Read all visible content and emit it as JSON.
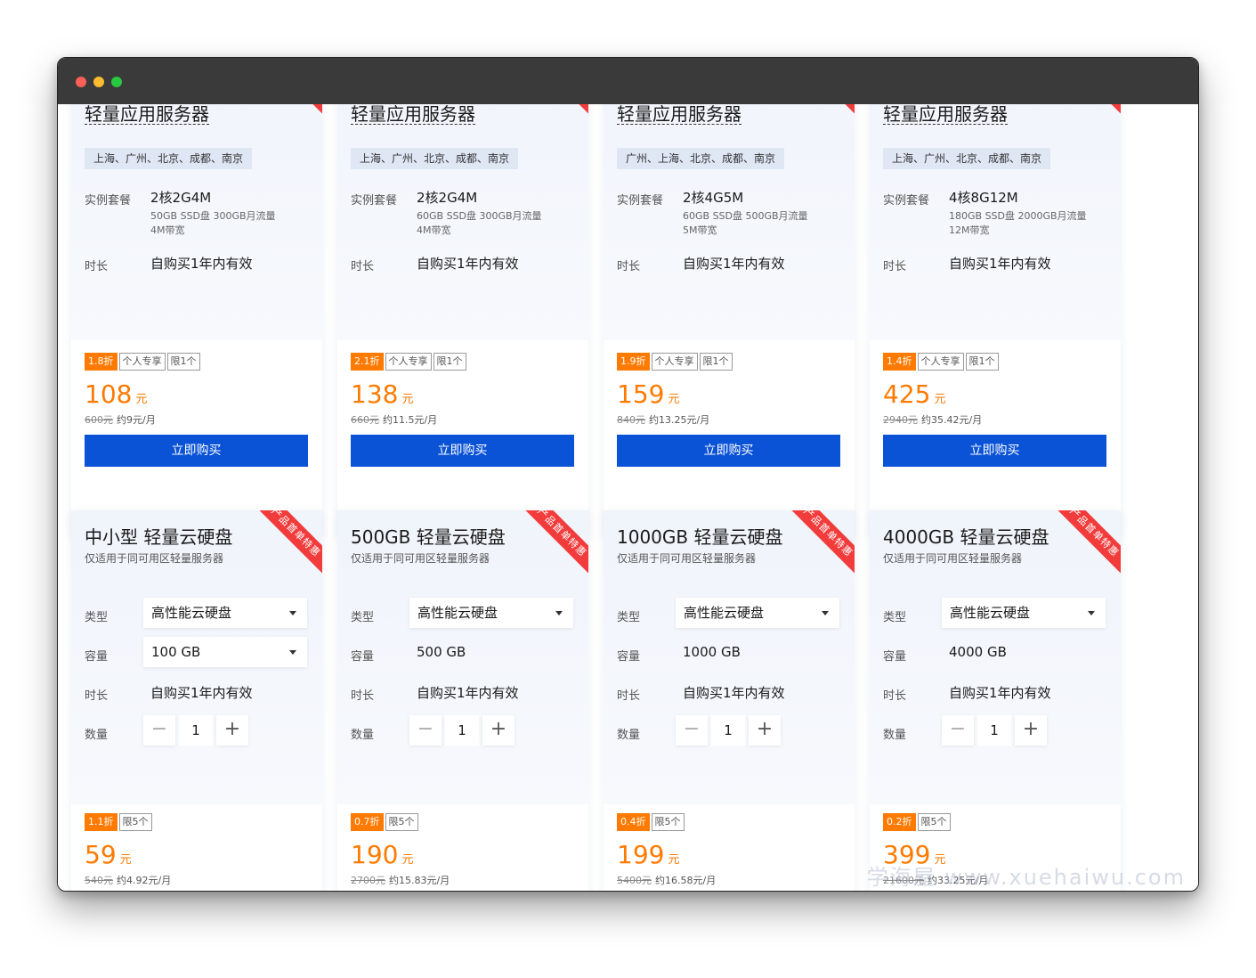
{
  "window": {
    "dots": [
      "close",
      "minimize",
      "maximize"
    ]
  },
  "ribbon_text": "产品首单特惠",
  "labels": {
    "instance": "实例套餐",
    "duration": "时长",
    "type": "类型",
    "capacity": "容量",
    "quantity": "数量",
    "buy": "立即购买",
    "unit": "元"
  },
  "servers": [
    {
      "title": "轻量应用服务器",
      "regions": "上海、广州、北京、成都、南京",
      "spec": "2核2G4M",
      "spec_sub1": "50GB SSD盘 300GB月流量",
      "spec_sub2": "4M带宽",
      "duration": "自购买1年内有效",
      "discount": "1.8折",
      "tag1": "个人专享",
      "tag2": "限1个",
      "price": "108",
      "orig_price": "600元",
      "monthly": "约9元/月"
    },
    {
      "title": "轻量应用服务器",
      "regions": "上海、广州、北京、成都、南京",
      "spec": "2核2G4M",
      "spec_sub1": "60GB SSD盘 300GB月流量",
      "spec_sub2": "4M带宽",
      "duration": "自购买1年内有效",
      "discount": "2.1折",
      "tag1": "个人专享",
      "tag2": "限1个",
      "price": "138",
      "orig_price": "660元",
      "monthly": "约11.5元/月"
    },
    {
      "title": "轻量应用服务器",
      "regions": "广州、上海、北京、成都、南京",
      "spec": "2核4G5M",
      "spec_sub1": "60GB SSD盘 500GB月流量",
      "spec_sub2": "5M带宽",
      "duration": "自购买1年内有效",
      "discount": "1.9折",
      "tag1": "个人专享",
      "tag2": "限1个",
      "price": "159",
      "orig_price": "840元",
      "monthly": "约13.25元/月"
    },
    {
      "title": "轻量应用服务器",
      "regions": "上海、广州、北京、成都、南京",
      "spec": "4核8G12M",
      "spec_sub1": "180GB SSD盘 2000GB月流量",
      "spec_sub2": "12M带宽",
      "duration": "自购买1年内有效",
      "discount": "1.4折",
      "tag1": "个人专享",
      "tag2": "限1个",
      "price": "425",
      "orig_price": "2940元",
      "monthly": "约35.42元/月"
    }
  ],
  "disks": [
    {
      "title": "中小型 轻量云硬盘",
      "subtitle": "仅适用于同可用区轻量服务器",
      "type": "高性能云硬盘",
      "capacity": "100 GB",
      "capacity_select": true,
      "duration": "自购买1年内有效",
      "qty": "1",
      "discount": "1.1折",
      "tag": "限5个",
      "price": "59",
      "orig_price": "540元",
      "monthly": "约4.92元/月"
    },
    {
      "title": "500GB 轻量云硬盘",
      "subtitle": "仅适用于同可用区轻量服务器",
      "type": "高性能云硬盘",
      "capacity": "500 GB",
      "capacity_select": false,
      "duration": "自购买1年内有效",
      "qty": "1",
      "discount": "0.7折",
      "tag": "限5个",
      "price": "190",
      "orig_price": "2700元",
      "monthly": "约15.83元/月"
    },
    {
      "title": "1000GB 轻量云硬盘",
      "subtitle": "仅适用于同可用区轻量服务器",
      "type": "高性能云硬盘",
      "capacity": "1000 GB",
      "capacity_select": false,
      "duration": "自购买1年内有效",
      "qty": "1",
      "discount": "0.4折",
      "tag": "限5个",
      "price": "199",
      "orig_price": "5400元",
      "monthly": "约16.58元/月"
    },
    {
      "title": "4000GB 轻量云硬盘",
      "subtitle": "仅适用于同可用区轻量服务器",
      "type": "高性能云硬盘",
      "capacity": "4000 GB",
      "capacity_select": false,
      "duration": "自购买1年内有效",
      "qty": "1",
      "discount": "0.2折",
      "tag": "限5个",
      "price": "399",
      "orig_price": "21600元",
      "monthly": "约33.25元/月"
    }
  ],
  "watermark": "学海屋 www.xuehaiwu.com",
  "colors": {
    "accent": "#0a52d6",
    "price": "#ff7a00",
    "ribbon": "#f23c3c"
  }
}
